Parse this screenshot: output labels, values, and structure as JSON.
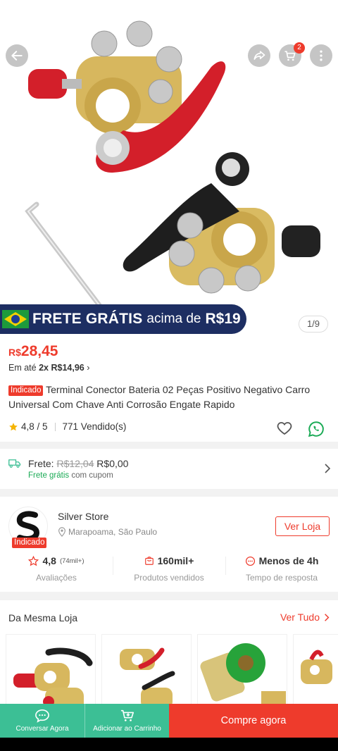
{
  "topbar": {
    "back_icon": "arrow-left-icon",
    "share_icon": "share-icon",
    "cart_icon": "cart-icon",
    "cart_badge": "2",
    "more_icon": "more-vertical-icon"
  },
  "banner": {
    "main": "FRETE GRÁTIS",
    "sub": "acima de",
    "amount": "R$19"
  },
  "gallery": {
    "counter": "1/9"
  },
  "product": {
    "currency": "R$",
    "price": "28,45",
    "installment_prefix": "Em até",
    "installment_value": "2x R$14,96",
    "installment_arrow": "›",
    "tag": "Indicado",
    "title": "Terminal Conector Bateria 02 Peças Positivo Negativo Carro Universal Com Chave Anti Corrosão Engate Rapido",
    "rating": "4,8 / 5",
    "sold": "771 Vendido(s)"
  },
  "shipping": {
    "label": "Frete:",
    "old_price": "R$12,04",
    "new_price": "R$0,00",
    "free_text": "Frete grátis",
    "coupon_text": "com cupom"
  },
  "store": {
    "name": "Silver Store",
    "location": "Marapoama, São Paulo",
    "tag": "Indicado",
    "visit_label": "Ver Loja",
    "stats": [
      {
        "value": "4,8",
        "extra": "(74mil+)",
        "label": "Avaliações",
        "icon": "star-outline-icon"
      },
      {
        "value": "160mil+",
        "extra": "",
        "label": "Produtos vendidos",
        "icon": "bag-icon"
      },
      {
        "value": "Menos de 4h",
        "extra": "",
        "label": "Tempo de resposta",
        "icon": "chat-dots-icon"
      }
    ]
  },
  "same_store": {
    "heading": "Da Mesma Loja",
    "see_all": "Ver Tudo"
  },
  "bottom_bar": {
    "chat_label": "Conversar Agora",
    "cart_label": "Adicionar ao Carrinho",
    "buy_label": "Compre agora"
  },
  "colors": {
    "accent": "#ee3b2c",
    "green": "#3cbf95",
    "banner": "#1d2e62"
  }
}
